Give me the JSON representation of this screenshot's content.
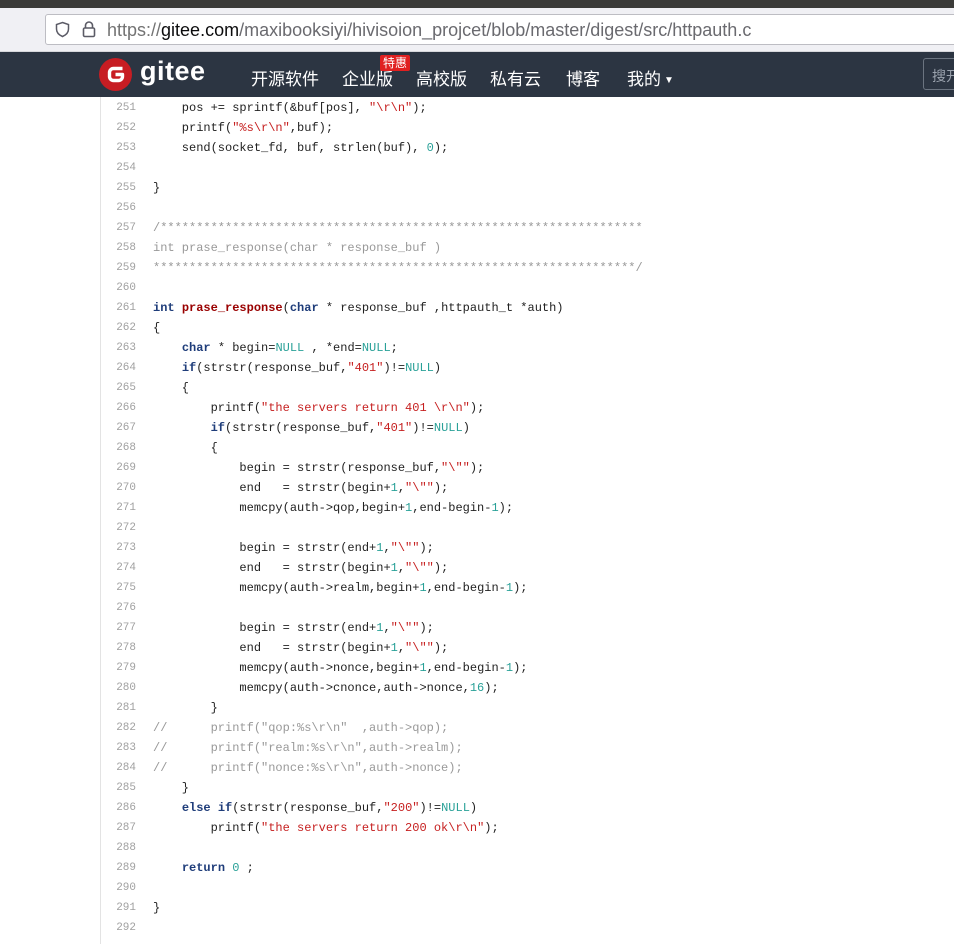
{
  "browser": {
    "url_proto": "https://",
    "url_host": "gitee.com",
    "url_path": "/maxibooksiyi/hivisoion_projcet/blob/master/digest/src/httpauth.c"
  },
  "nav": {
    "logo_text": "gitee",
    "items": [
      "开源软件",
      "企业版",
      "高校版",
      "私有云",
      "博客",
      "我的"
    ],
    "badge": "特惠",
    "search_placeholder": "搜开"
  },
  "code": {
    "lines": [
      {
        "n": "251",
        "html": "    pos += sprintf(&buf[pos], <span class=\"s\">\"\\r\\n\"</span>);"
      },
      {
        "n": "252",
        "html": "    printf(<span class=\"s\">\"%s\\r\\n\"</span>,buf);"
      },
      {
        "n": "253",
        "html": "    send(socket_fd, buf, strlen(buf), <span class=\"n\">0</span>);"
      },
      {
        "n": "254",
        "html": ""
      },
      {
        "n": "255",
        "html": "}"
      },
      {
        "n": "256",
        "html": ""
      },
      {
        "n": "257",
        "html": "<span class=\"c\">/*******************************************************************</span>"
      },
      {
        "n": "258",
        "html": "<span class=\"c\">int prase_response(char * response_buf )</span>"
      },
      {
        "n": "259",
        "html": "<span class=\"c\">*******************************************************************/</span>"
      },
      {
        "n": "260",
        "html": ""
      },
      {
        "n": "261",
        "html": "<span class=\"k\">int</span> <span class=\"f\">prase_response</span>(<span class=\"k\">char</span> * response_buf ,httpauth_t *auth)"
      },
      {
        "n": "262",
        "html": "{"
      },
      {
        "n": "263",
        "html": "    <span class=\"k\">char</span> * begin=<span class=\"n\">NULL</span> , *end=<span class=\"n\">NULL</span>;"
      },
      {
        "n": "264",
        "html": "    <span class=\"k\">if</span>(strstr(response_buf,<span class=\"s\">\"401\"</span>)!=<span class=\"n\">NULL</span>)"
      },
      {
        "n": "265",
        "html": "    {"
      },
      {
        "n": "266",
        "html": "        printf(<span class=\"s\">\"the servers return 401 \\r\\n\"</span>);"
      },
      {
        "n": "267",
        "html": "        <span class=\"k\">if</span>(strstr(response_buf,<span class=\"s\">\"401\"</span>)!=<span class=\"n\">NULL</span>)"
      },
      {
        "n": "268",
        "html": "        {"
      },
      {
        "n": "269",
        "html": "            begin = strstr(response_buf,<span class=\"s\">\"\\\"\"</span>);"
      },
      {
        "n": "270",
        "html": "            end   = strstr(begin+<span class=\"n\">1</span>,<span class=\"s\">\"\\\"\"</span>);"
      },
      {
        "n": "271",
        "html": "            memcpy(auth->qop,begin+<span class=\"n\">1</span>,end-begin-<span class=\"n\">1</span>);"
      },
      {
        "n": "272",
        "html": ""
      },
      {
        "n": "273",
        "html": "            begin = strstr(end+<span class=\"n\">1</span>,<span class=\"s\">\"\\\"\"</span>);"
      },
      {
        "n": "274",
        "html": "            end   = strstr(begin+<span class=\"n\">1</span>,<span class=\"s\">\"\\\"\"</span>);"
      },
      {
        "n": "275",
        "html": "            memcpy(auth->realm,begin+<span class=\"n\">1</span>,end-begin-<span class=\"n\">1</span>);"
      },
      {
        "n": "276",
        "html": ""
      },
      {
        "n": "277",
        "html": "            begin = strstr(end+<span class=\"n\">1</span>,<span class=\"s\">\"\\\"\"</span>);"
      },
      {
        "n": "278",
        "html": "            end   = strstr(begin+<span class=\"n\">1</span>,<span class=\"s\">\"\\\"\"</span>);"
      },
      {
        "n": "279",
        "html": "            memcpy(auth->nonce,begin+<span class=\"n\">1</span>,end-begin-<span class=\"n\">1</span>);"
      },
      {
        "n": "280",
        "html": "            memcpy(auth->cnonce,auth->nonce,<span class=\"n\">16</span>);"
      },
      {
        "n": "281",
        "html": "        }"
      },
      {
        "n": "282",
        "html": "<span class=\"c\">//      printf(\"qop:%s\\r\\n\"  ,auth->qop);</span>"
      },
      {
        "n": "283",
        "html": "<span class=\"c\">//      printf(\"realm:%s\\r\\n\",auth->realm);</span>"
      },
      {
        "n": "284",
        "html": "<span class=\"c\">//      printf(\"nonce:%s\\r\\n\",auth->nonce);</span>"
      },
      {
        "n": "285",
        "html": "    }"
      },
      {
        "n": "286",
        "html": "    <span class=\"k\">else</span> <span class=\"k\">if</span>(strstr(response_buf,<span class=\"s\">\"200\"</span>)!=<span class=\"n\">NULL</span>)"
      },
      {
        "n": "287",
        "html": "        printf(<span class=\"s\">\"the servers return 200 ok\\r\\n\"</span>);"
      },
      {
        "n": "288",
        "html": ""
      },
      {
        "n": "289",
        "html": "    <span class=\"k\">return</span> <span class=\"n\">0</span> ;"
      },
      {
        "n": "290",
        "html": ""
      },
      {
        "n": "291",
        "html": "}"
      },
      {
        "n": "292",
        "html": ""
      }
    ]
  }
}
